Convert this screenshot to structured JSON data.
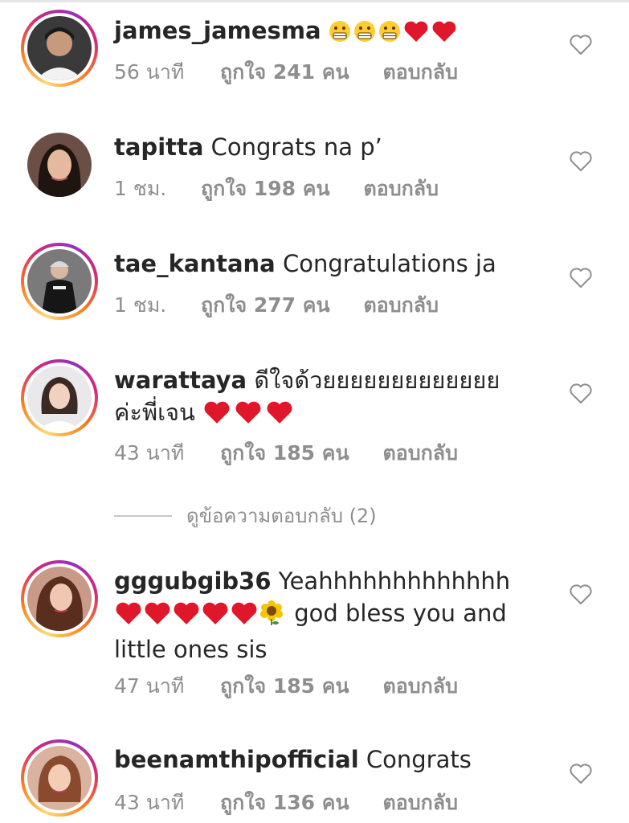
{
  "comments": [
    {
      "username": "james_jamesma",
      "text": "",
      "time": "56 นาที",
      "likes": "ถูกใจ 241 คน",
      "reply": "ตอบกลับ",
      "emojis": [
        "grimace",
        "grimace",
        "grimace",
        "red-heart",
        "red-heart"
      ],
      "story_ring": true
    },
    {
      "username": "tapitta",
      "text": "Congrats na p’",
      "time": "1 ชม.",
      "likes": "ถูกใจ 198 คน",
      "reply": "ตอบกลับ",
      "story_ring": false
    },
    {
      "username": "tae_kantana",
      "text": "Congratulations ja",
      "time": "1 ชม.",
      "likes": "ถูกใจ 277 คน",
      "reply": "ตอบกลับ",
      "story_ring": true
    },
    {
      "username": "warattaya",
      "text_line1": "ดีใจด้วยยยยยยยยยยยยย",
      "text_line2": "ค่ะพี่เจน",
      "time": "43 นาที",
      "likes": "ถูกใจ 185 คน",
      "reply": "ตอบกลับ",
      "emojis": [
        "red-heart",
        "red-heart",
        "red-heart"
      ],
      "story_ring": true
    },
    {
      "username": "gggubgib36",
      "text_line1": "Yeahhhhhhhhhhhhh",
      "text_line2": "god bless you and",
      "text_line3": "little ones sis",
      "time": "47 นาที",
      "likes": "ถูกใจ 185 คน",
      "reply": "ตอบกลับ",
      "emojis": [
        "red-heart",
        "red-heart",
        "red-heart",
        "red-heart",
        "red-heart",
        "sunflower"
      ],
      "story_ring": true
    },
    {
      "username": "beenamthipofficial",
      "text": "Congrats",
      "time": "43 นาที",
      "likes": "ถูกใจ 136 คน",
      "reply": "ตอบกลับ",
      "story_ring": true
    }
  ],
  "view_replies": "ดูข้อความตอบกลับ (2)",
  "colors": {
    "text": "#262626",
    "meta": "#8e8e8e",
    "heart_outline": "#8e8e8e",
    "ring_start": "#feda75",
    "ring_end": "#962fbf"
  }
}
